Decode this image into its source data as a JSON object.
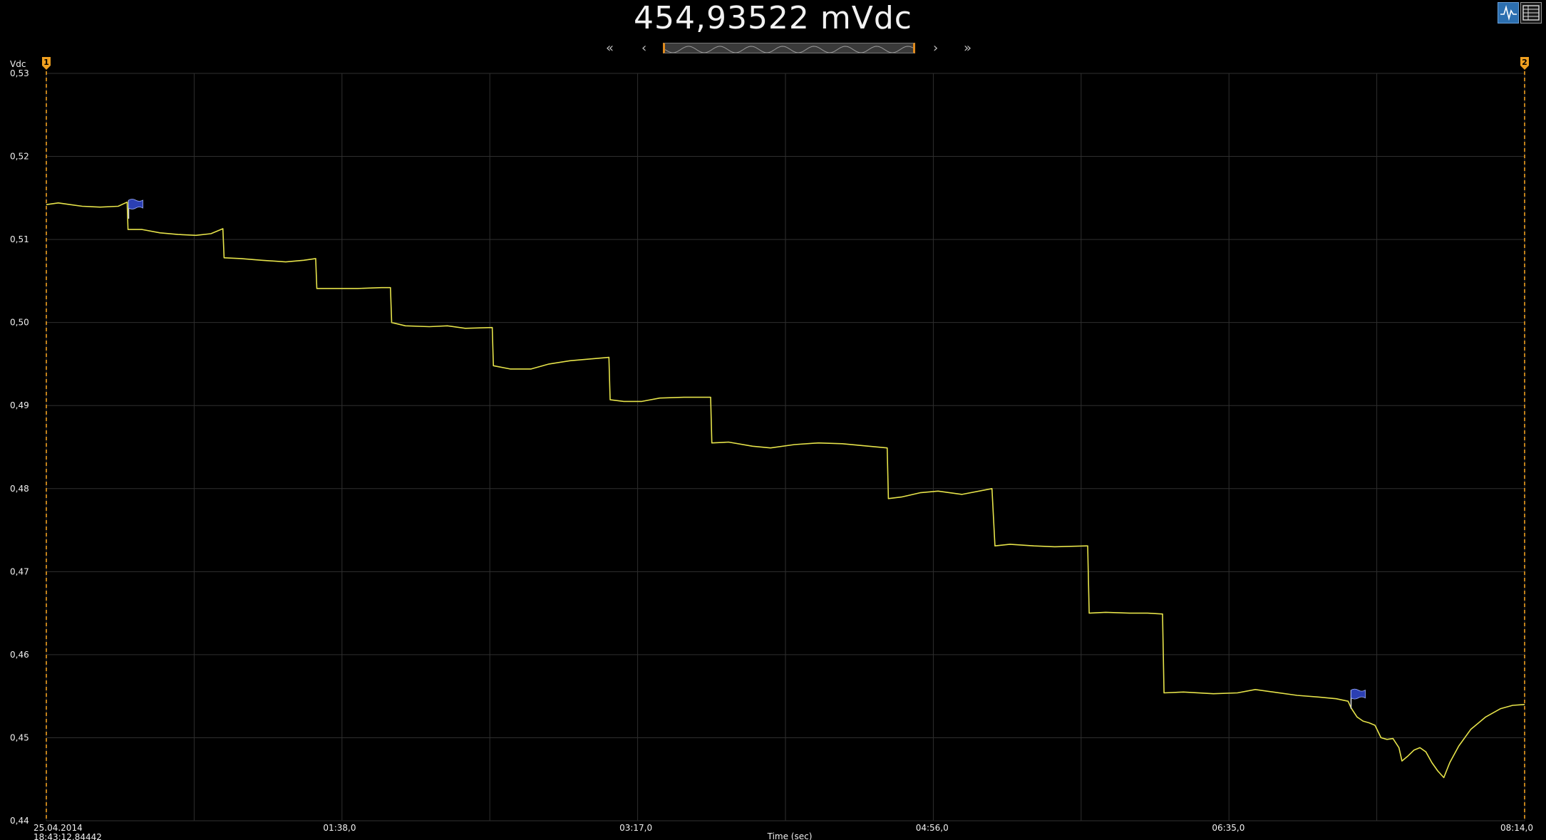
{
  "header": {
    "reading": "454,93522  mVdc",
    "nav": {
      "first": "«",
      "prev": "‹",
      "next": "›",
      "last": "»"
    }
  },
  "toolbar_icons": [
    "waveform-view-icon",
    "table-view-icon"
  ],
  "colors": {
    "background": "#000000",
    "grid": "#2f2f2f",
    "trace": "#e6e34a",
    "cursor": "#f0a020",
    "marker": "#2b3fb3"
  },
  "cursors": [
    {
      "label": "1",
      "x": 0
    },
    {
      "label": "2",
      "x": 494
    }
  ],
  "timestamp": {
    "date": "25.04.2014",
    "time": "18:43:12,84442"
  },
  "chart_data": {
    "type": "line",
    "ylabel": "Vdc",
    "xlabel": "Time (sec)",
    "ylim": [
      0.44,
      0.53
    ],
    "xlim": [
      0,
      494
    ],
    "yticks": [
      "0,44",
      "0,45",
      "0,46",
      "0,47",
      "0,48",
      "0,49",
      "0,50",
      "0,51",
      "0,52",
      "0,53"
    ],
    "xticks": [
      {
        "value": 98,
        "label": "01:38,0"
      },
      {
        "value": 197,
        "label": "03:17,0"
      },
      {
        "value": 296,
        "label": "04:56,0"
      },
      {
        "value": 395,
        "label": "06:35,0"
      },
      {
        "value": 494,
        "label": "08:14,0"
      }
    ],
    "grid": true,
    "markers": [
      {
        "x": 27.5,
        "y": 0.5125
      },
      {
        "x": 436,
        "y": 0.4535
      }
    ],
    "series": [
      {
        "points": [
          [
            0,
            0.5142
          ],
          [
            4,
            0.5144
          ],
          [
            8,
            0.5142
          ],
          [
            12,
            0.514
          ],
          [
            18,
            0.5139
          ],
          [
            24,
            0.514
          ],
          [
            27,
            0.5145
          ],
          [
            27.3,
            0.5112
          ],
          [
            32,
            0.5112
          ],
          [
            38,
            0.5108
          ],
          [
            44,
            0.5106
          ],
          [
            50,
            0.5105
          ],
          [
            55,
            0.5107
          ],
          [
            59,
            0.5113
          ],
          [
            59.4,
            0.5078
          ],
          [
            65,
            0.5077
          ],
          [
            72,
            0.5075
          ],
          [
            80,
            0.5073
          ],
          [
            86,
            0.5075
          ],
          [
            90,
            0.5077
          ],
          [
            90.4,
            0.5041
          ],
          [
            96,
            0.5041
          ],
          [
            104,
            0.5041
          ],
          [
            112,
            0.5042
          ],
          [
            115,
            0.5042
          ],
          [
            115.4,
            0.5
          ],
          [
            120,
            0.4996
          ],
          [
            128,
            0.4995
          ],
          [
            134,
            0.4996
          ],
          [
            140,
            0.4993
          ],
          [
            149,
            0.4994
          ],
          [
            149.4,
            0.4948
          ],
          [
            155,
            0.4944
          ],
          [
            162,
            0.4944
          ],
          [
            168,
            0.495
          ],
          [
            175,
            0.4954
          ],
          [
            188,
            0.4958
          ],
          [
            188.4,
            0.4907
          ],
          [
            193,
            0.4905
          ],
          [
            199,
            0.4905
          ],
          [
            205,
            0.4909
          ],
          [
            213,
            0.491
          ],
          [
            222,
            0.491
          ],
          [
            222.4,
            0.4855
          ],
          [
            228,
            0.4856
          ],
          [
            236,
            0.4851
          ],
          [
            242,
            0.4849
          ],
          [
            250,
            0.4853
          ],
          [
            258,
            0.4855
          ],
          [
            266,
            0.4854
          ],
          [
            281,
            0.4849
          ],
          [
            281.4,
            0.4788
          ],
          [
            286,
            0.479
          ],
          [
            292,
            0.4795
          ],
          [
            298,
            0.4797
          ],
          [
            306,
            0.4793
          ],
          [
            316,
            0.48
          ],
          [
            317,
            0.4731
          ],
          [
            322,
            0.4733
          ],
          [
            330,
            0.4731
          ],
          [
            337,
            0.473
          ],
          [
            348,
            0.4731
          ],
          [
            348.5,
            0.465
          ],
          [
            354,
            0.4651
          ],
          [
            362,
            0.465
          ],
          [
            368,
            0.465
          ],
          [
            373,
            0.4649
          ],
          [
            373.5,
            0.4554
          ],
          [
            380,
            0.4555
          ],
          [
            390,
            0.4553
          ],
          [
            398,
            0.4554
          ],
          [
            404,
            0.4558
          ],
          [
            410,
            0.4555
          ],
          [
            418,
            0.4551
          ],
          [
            425,
            0.4549
          ],
          [
            431,
            0.4547
          ],
          [
            435,
            0.4544
          ],
          [
            436,
            0.4536
          ],
          [
            438,
            0.4525
          ],
          [
            440,
            0.452
          ],
          [
            442,
            0.4518
          ],
          [
            444,
            0.4515
          ],
          [
            446,
            0.45
          ],
          [
            448,
            0.4498
          ],
          [
            450,
            0.4499
          ],
          [
            452,
            0.4488
          ],
          [
            453,
            0.4472
          ],
          [
            455,
            0.4478
          ],
          [
            457,
            0.4485
          ],
          [
            459,
            0.4488
          ],
          [
            461,
            0.4483
          ],
          [
            463,
            0.447
          ],
          [
            465,
            0.446
          ],
          [
            467,
            0.4452
          ],
          [
            469,
            0.447
          ],
          [
            472,
            0.449
          ],
          [
            476,
            0.451
          ],
          [
            481,
            0.4525
          ],
          [
            486,
            0.4535
          ],
          [
            490,
            0.4539
          ],
          [
            494,
            0.454
          ]
        ]
      }
    ]
  }
}
